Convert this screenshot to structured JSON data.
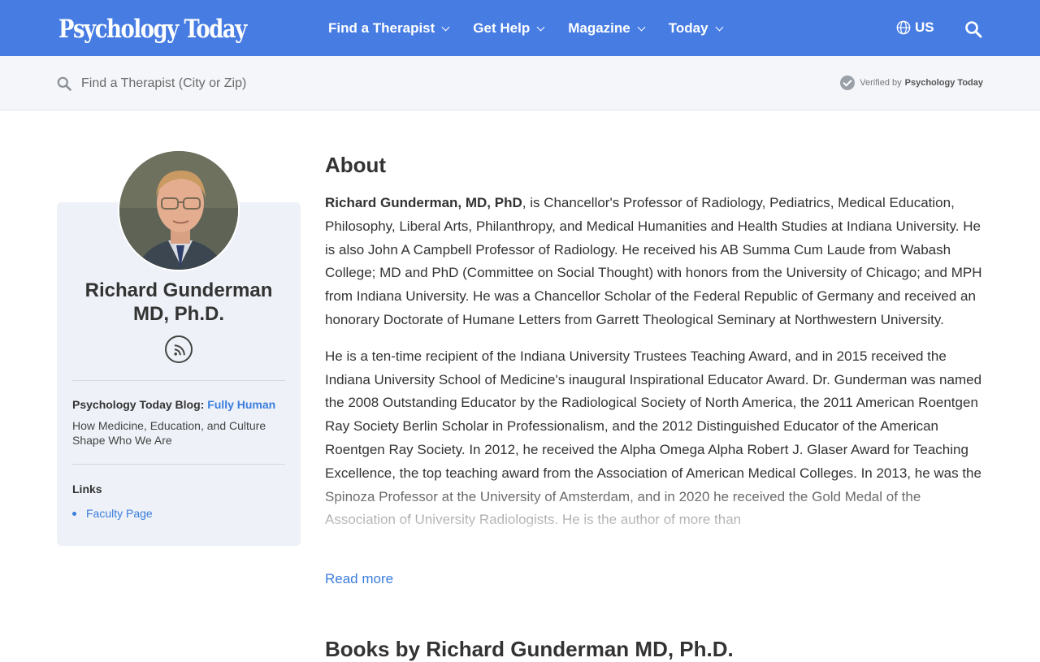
{
  "nav": {
    "logo": "Psychology Today",
    "items": [
      {
        "label": "Find a Therapist"
      },
      {
        "label": "Get Help"
      },
      {
        "label": "Magazine"
      },
      {
        "label": "Today"
      }
    ],
    "locale": "US"
  },
  "search": {
    "placeholder": "Find a Therapist (City or Zip)",
    "verified_prefix": "Verified by",
    "verified_brand": "Psychology Today"
  },
  "profile": {
    "name_line1": "Richard Gunderman",
    "name_line2": "MD, Ph.D.",
    "blog_label": "Psychology Today Blog:",
    "blog_name": "Fully Human",
    "blog_description": "How Medicine, Education, and Culture Shape Who We Are",
    "links_heading": "Links",
    "links": [
      {
        "label": "Faculty Page"
      }
    ]
  },
  "about": {
    "title": "About",
    "bio_name": "Richard Gunderman, MD, PhD",
    "paragraph1_rest": ", is Chancellor's Professor of Radiology, Pediatrics, Medical Education, Philosophy, Liberal Arts, Philanthropy, and Medical Humanities and Health Studies at Indiana University. He is also John A Campbell Professor of Radiology. He received his AB Summa Cum Laude from Wabash College; MD and PhD (Committee on Social Thought) with honors from the University of Chicago; and MPH from Indiana University. He was a Chancellor Scholar of the Federal Republic of Germany and received an honorary Doctorate of Humane Letters from Garrett Theological Seminary at Northwestern University.",
    "paragraph2": "He is a ten-time recipient of the Indiana University Trustees Teaching Award, and in 2015 received the Indiana University School of Medicine's inaugural Inspirational Educator Award. Dr. Gunderman was named the 2008 Outstanding Educator by the Radiological Society of North America, the 2011 American Roentgen Ray Society Berlin Scholar in Professionalism, and the 2012 Distinguished Educator of the American Roentgen Ray Society. In 2012, he received the Alpha Omega Alpha Robert J. Glaser Award for Teaching Excellence, the top teaching award from the Association of American Medical Colleges. In 2013, he was the Spinoza Professor at the University of Amsterdam, and in 2020 he received the Gold Medal of the Association of University Radiologists. He is the author of more than",
    "read_more": "Read more"
  },
  "books": {
    "title": "Books by Richard Gunderman MD, Ph.D."
  },
  "colors": {
    "brand_blue": "#477ce3",
    "link_blue": "#3b7ddd",
    "card_bg": "#eef2f8"
  }
}
